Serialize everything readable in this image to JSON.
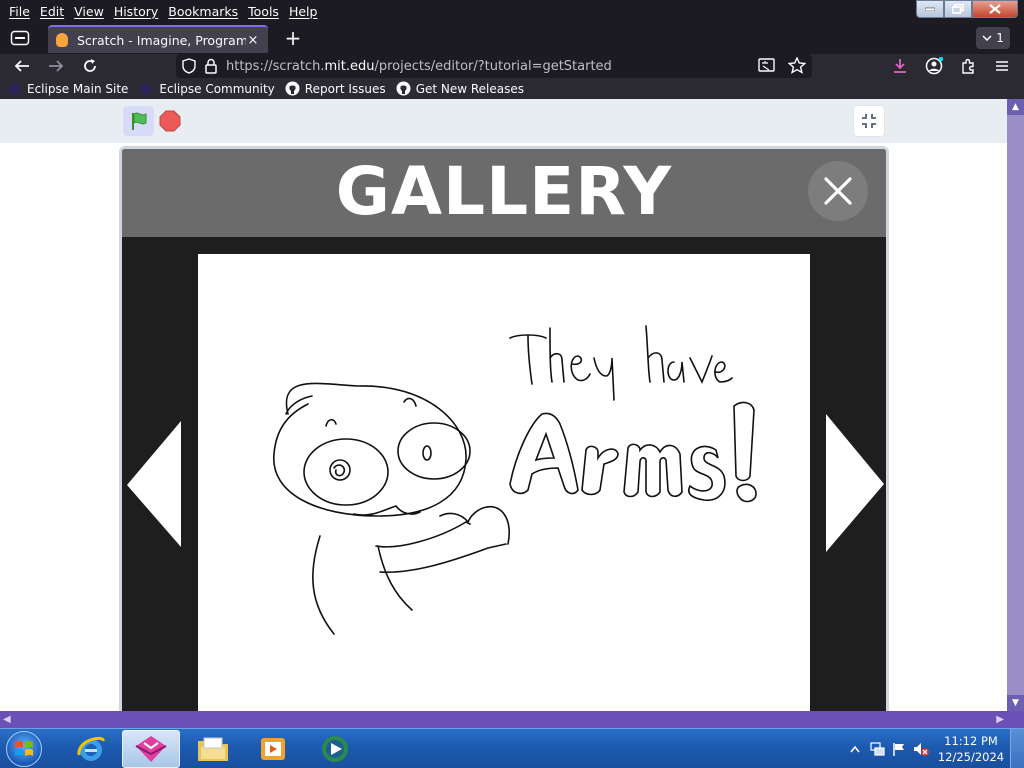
{
  "menu": [
    "File",
    "Edit",
    "View",
    "History",
    "Bookmarks",
    "Tools",
    "Help"
  ],
  "tab": {
    "title": "Scratch - Imagine, Program, Sha",
    "close_glyph": "×"
  },
  "newtab_glyph": "+",
  "tablist_count": "1",
  "url": {
    "prefix": "https://scratch.",
    "domain": "mit.edu",
    "suffix": "/projects/editor/?tutorial=getStarted"
  },
  "bookmarks": [
    {
      "label": "Eclipse Main Site",
      "icon": "eclipse-icon"
    },
    {
      "label": "Eclipse Community",
      "icon": "eclipse-icon"
    },
    {
      "label": "Report Issues",
      "icon": "github-icon"
    },
    {
      "label": "Get New Releases",
      "icon": "github-icon"
    }
  ],
  "gallery": {
    "title": "GALLERY",
    "image_text_line1": "They have",
    "image_text_line2": "Arms!"
  },
  "taskbar": {
    "items": [
      "internet-explorer-icon",
      "eclipse-browser-icon",
      "file-explorer-icon",
      "media-player-icon",
      "media-center-icon"
    ],
    "active_item": "eclipse-browser-icon",
    "clock_time": "11:12 PM",
    "clock_date": "12/25/2024"
  },
  "colors": {
    "browser_chrome": "#2b2a33",
    "tab_active": "#42414d",
    "scratch_stage_header": "#e8edf1",
    "gallery_header": "#6b6b6b",
    "scrollbar": "#6d4fb8"
  }
}
